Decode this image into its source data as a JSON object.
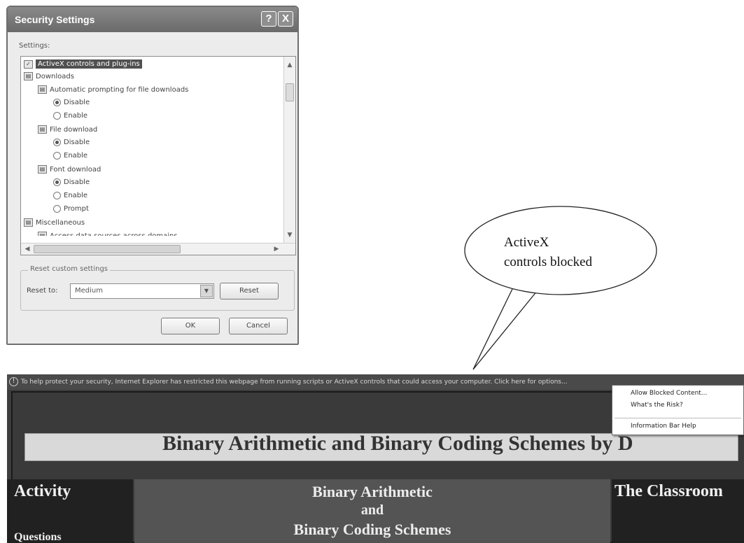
{
  "dialog": {
    "title": "Security Settings",
    "help_button": "?",
    "close_button": "X",
    "settings_label": "Settings:",
    "tree": {
      "activex": "ActiveX controls and plug-ins",
      "downloads": "Downloads",
      "auto_prompting": "Automatic prompting for file downloads",
      "auto_disable": "Disable",
      "auto_enable": "Enable",
      "file_download": "File download",
      "file_disable": "Disable",
      "file_enable": "Enable",
      "font_download": "Font download",
      "font_disable": "Disable",
      "font_enable": "Enable",
      "font_prompt": "Prompt",
      "miscellaneous": "Miscellaneous",
      "access_data": "Access data sources across domains"
    },
    "reset_group": {
      "caption": "Reset custom settings",
      "reset_to_label": "Reset to:",
      "reset_value": "Medium",
      "reset_button": "Reset"
    },
    "ok_button": "OK",
    "cancel_button": "Cancel"
  },
  "callout": {
    "line1": "ActiveX",
    "line2": "controls blocked"
  },
  "browser": {
    "infobar_text": "To help protect your security, Internet Explorer has restricted this webpage from running scripts or ActiveX controls that could access your computer. Click here for options...",
    "page_title": "Binary Arithmetic and Binary Coding Schemes by D",
    "left_heading": "Activity",
    "left_link": "Questions",
    "mid_line1": "Binary Arithmetic",
    "mid_line2": "and",
    "mid_line3": "Binary Coding Schemes",
    "right_heading": "The Classroom"
  },
  "context_menu": {
    "allow_blocked": "Allow Blocked Content...",
    "whats_risk": "What's the Risk?",
    "info_bar_help": "Information Bar Help"
  }
}
